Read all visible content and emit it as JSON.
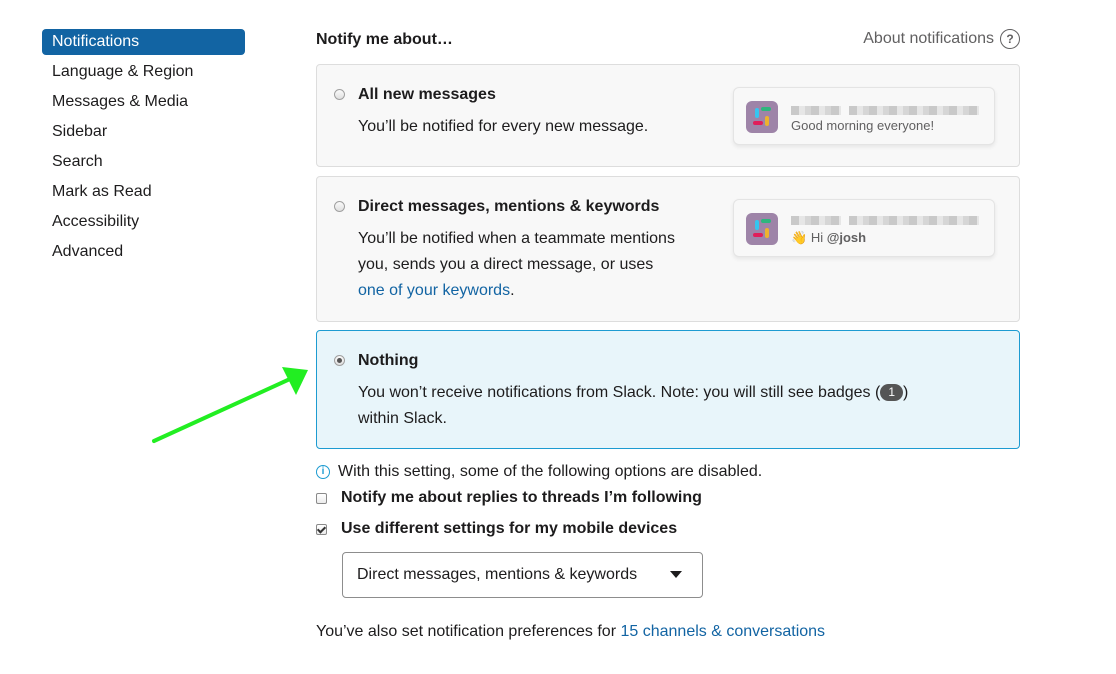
{
  "sidebar": {
    "items": [
      {
        "label": "Notifications"
      },
      {
        "label": "Language & Region"
      },
      {
        "label": "Messages & Media"
      },
      {
        "label": "Sidebar"
      },
      {
        "label": "Search"
      },
      {
        "label": "Mark as Read"
      },
      {
        "label": "Accessibility"
      },
      {
        "label": "Advanced"
      }
    ],
    "active_index": 0
  },
  "main": {
    "title": "Notify me about…",
    "about_link": "About notifications",
    "options": [
      {
        "title": "All new messages",
        "desc": "You’ll be notified for every new message.",
        "preview_text": "Good morning everyone!"
      },
      {
        "title": "Direct messages, mentions & keywords",
        "desc_line1": "You’ll be notified when a teammate mentions",
        "desc_line2": "you, sends you a direct message, or uses",
        "desc_link": "one of your keywords",
        "desc_end": ".",
        "preview_prefix": "Hi ",
        "preview_mention": "@josh"
      },
      {
        "title": "Nothing",
        "desc_line1_a": "You won’t receive notifications from Slack. Note: you will still see badges (",
        "badge": "1",
        "desc_line1_b": ")",
        "desc_line2": "within Slack."
      }
    ],
    "selected_option": 2,
    "info_text": "With this setting, some of the following options are disabled.",
    "checkbox_threads": {
      "label": "Notify me about replies to threads I’m following",
      "checked": false
    },
    "checkbox_mobile": {
      "label": "Use different settings for my mobile devices",
      "checked": true
    },
    "mobile_select": {
      "value": "Direct messages, mentions & keywords"
    },
    "footer_text": "You’ve also set notification preferences for ",
    "footer_link": "15 channels & conversations"
  },
  "colors": {
    "accent": "#1264a3",
    "selected_bg": "#e8f5fa",
    "selected_border": "#1d9bd1",
    "annotation_arrow": "#22ee22"
  }
}
